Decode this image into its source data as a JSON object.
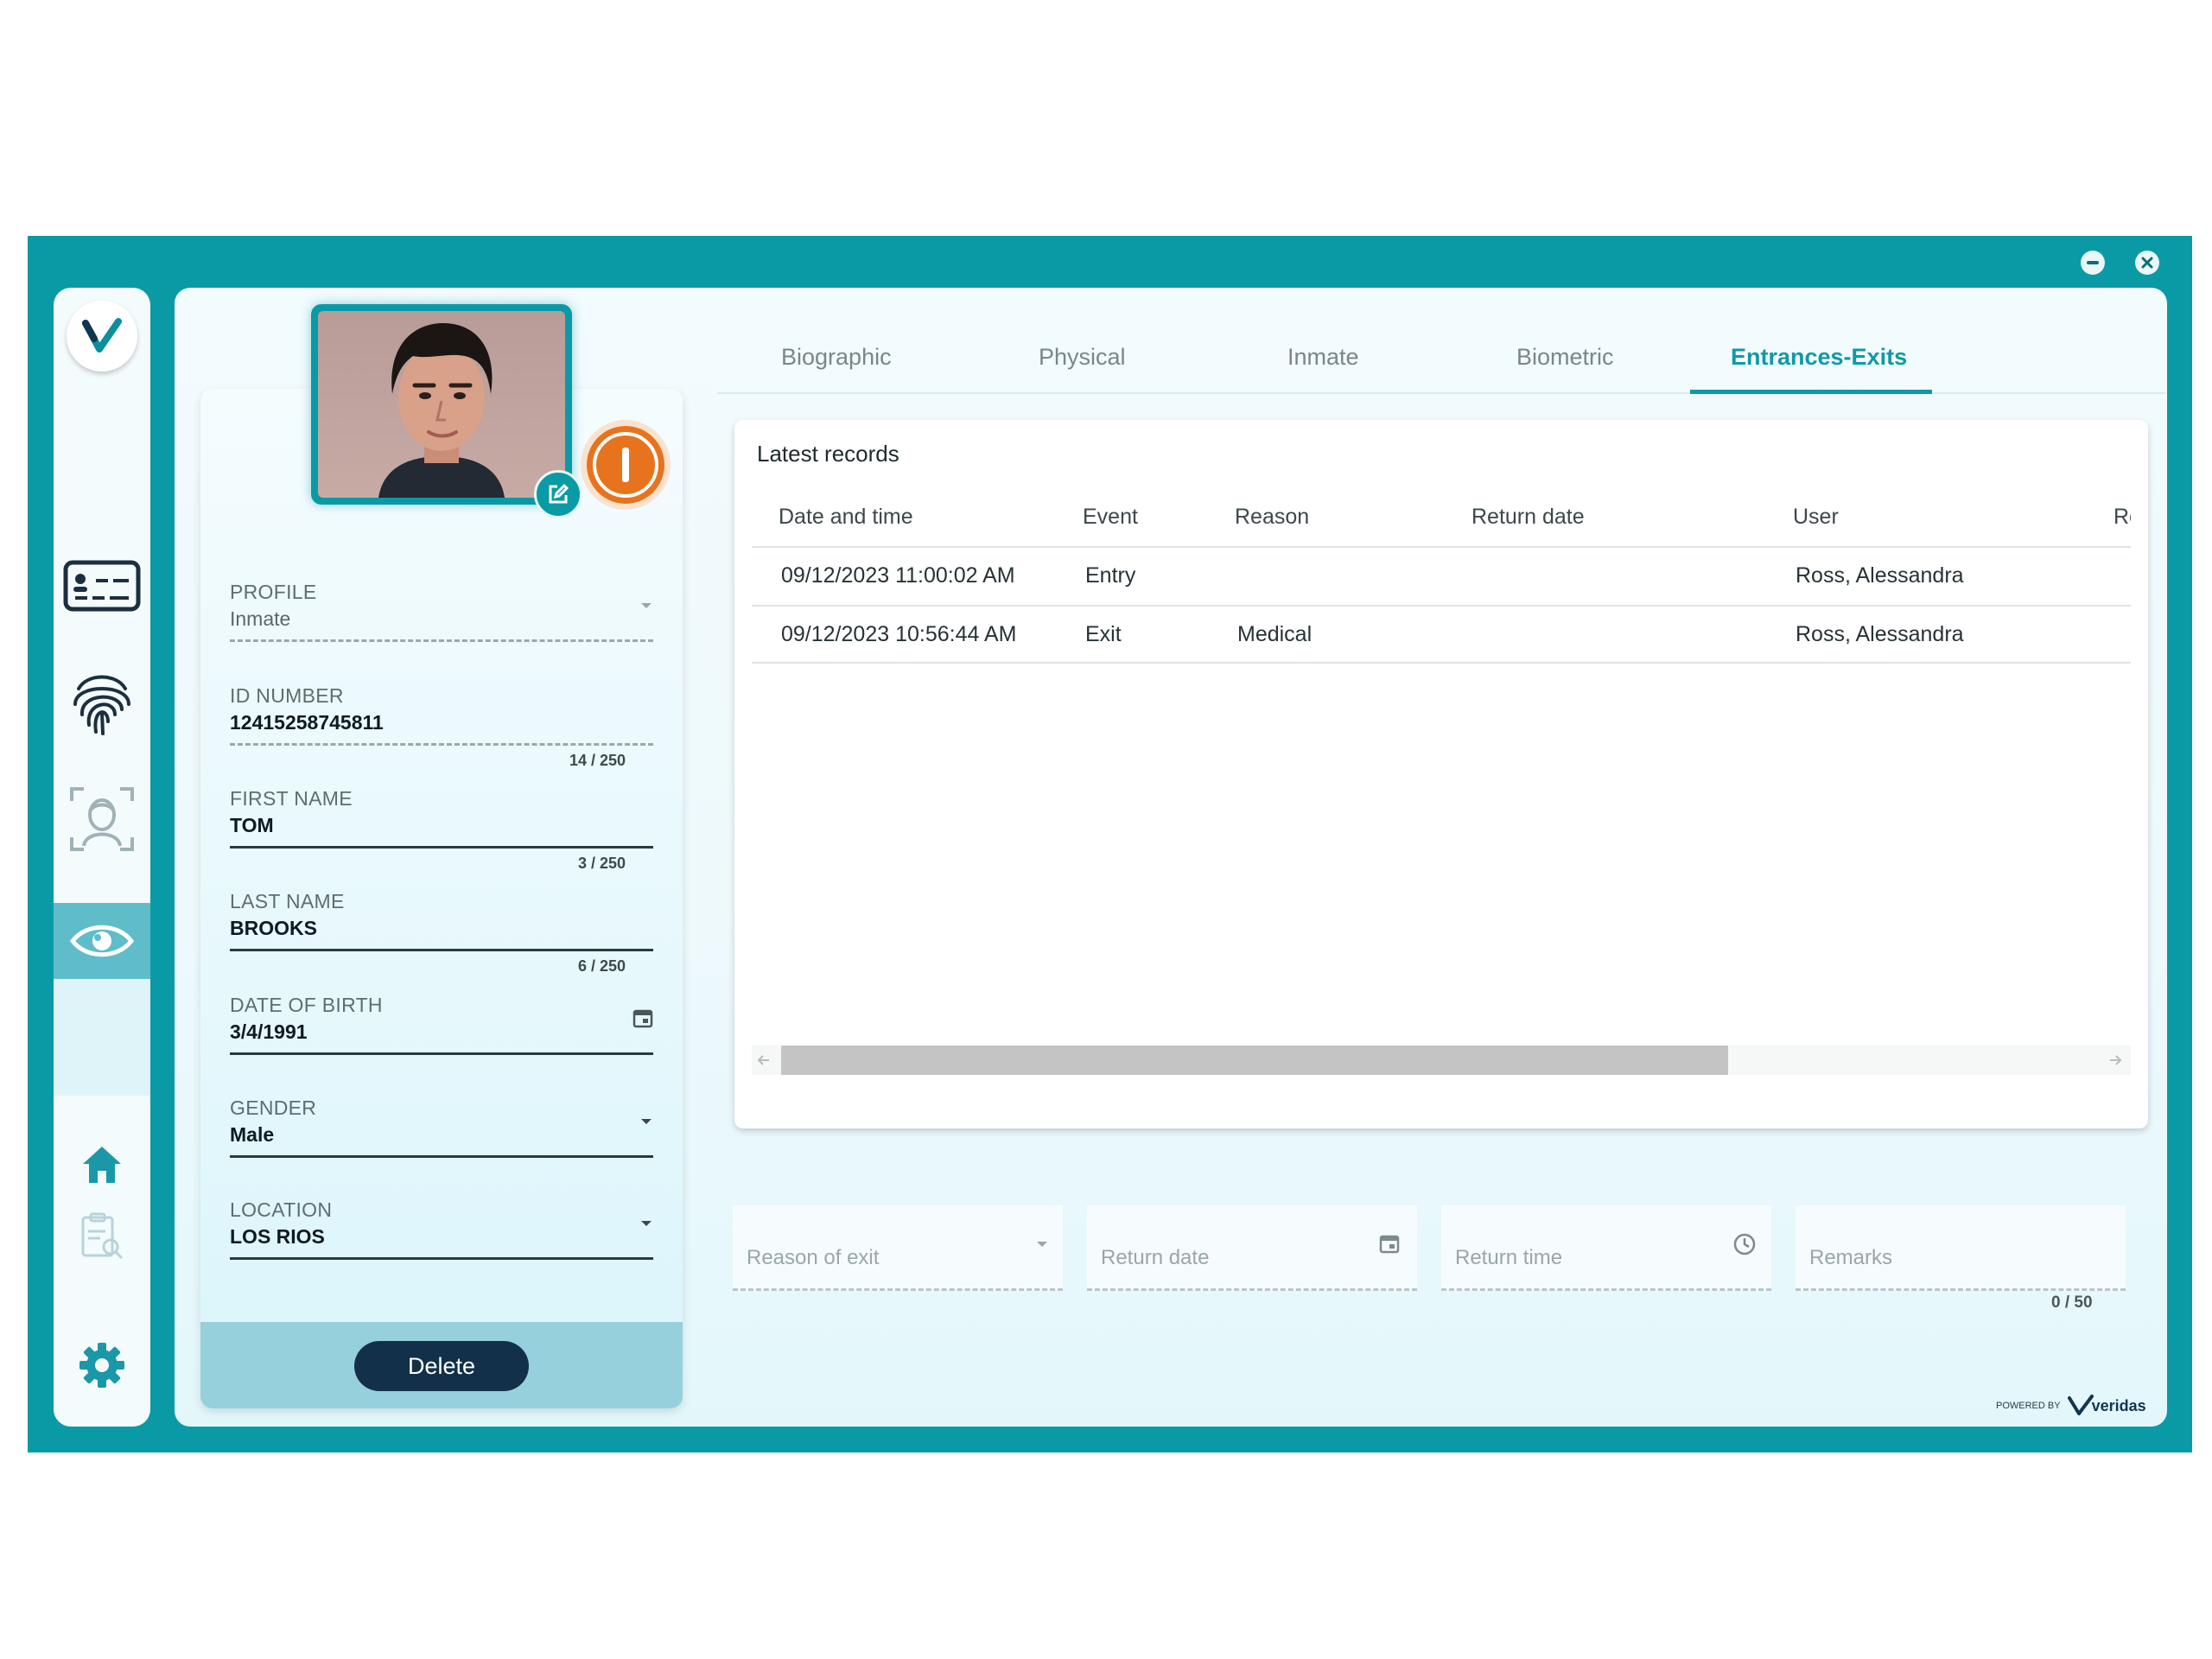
{
  "window": {
    "minimize_label": "minimize",
    "close_label": "close"
  },
  "brand": {
    "logo_letter": "V",
    "powered_by": "POWERED BY",
    "vendor": "veridas"
  },
  "sidebar": {
    "items": [
      {
        "name": "id-card",
        "active": false
      },
      {
        "name": "fingerprint",
        "active": false
      },
      {
        "name": "face-scan",
        "active": false
      },
      {
        "name": "eye",
        "active": true
      },
      {
        "name": "home",
        "active": false
      },
      {
        "name": "clipboard-search",
        "active": false
      },
      {
        "name": "settings",
        "active": false
      }
    ]
  },
  "profile_card": {
    "status_icon": "power-icon",
    "fields": {
      "profile": {
        "label": "PROFILE",
        "value": "Inmate"
      },
      "id_number": {
        "label": "ID NUMBER",
        "value": "12415258745811",
        "counter": "14 / 250"
      },
      "first_name": {
        "label": "FIRST NAME",
        "value": "TOM",
        "counter": "3 / 250"
      },
      "last_name": {
        "label": "LAST NAME",
        "value": "BROOKS",
        "counter": "6 / 250"
      },
      "dob": {
        "label": "DATE OF BIRTH",
        "value": "3/4/1991"
      },
      "gender": {
        "label": "GENDER",
        "value": "Male"
      },
      "location": {
        "label": "LOCATION",
        "value": "LOS RIOS"
      }
    },
    "delete_label": "Delete"
  },
  "tabs": [
    {
      "label": "Biographic",
      "active": false
    },
    {
      "label": "Physical",
      "active": false
    },
    {
      "label": "Inmate",
      "active": false
    },
    {
      "label": "Biometric",
      "active": false
    },
    {
      "label": "Entrances-Exits",
      "active": true
    }
  ],
  "records": {
    "title": "Latest records",
    "columns": [
      "Date and time",
      "Event",
      "Reason",
      "Return date",
      "User",
      "Re"
    ],
    "rows": [
      {
        "datetime": "09/12/2023 11:00:02 AM",
        "event": "Entry",
        "reason": "",
        "return_date": "",
        "user": "Ross, Alessandra"
      },
      {
        "datetime": "09/12/2023 10:56:44 AM",
        "event": "Exit",
        "reason": "Medical",
        "return_date": "",
        "user": "Ross, Alessandra"
      }
    ]
  },
  "exit_form": {
    "reason_placeholder": "Reason of exit",
    "return_date_placeholder": "Return date",
    "return_time_placeholder": "Return time",
    "remarks_placeholder": "Remarks",
    "remarks_counter": "0 / 50"
  },
  "colors": {
    "teal": "#0a9aa6",
    "accent": "#0e9aa7",
    "orange": "#e8731e",
    "navy": "#12304a"
  }
}
